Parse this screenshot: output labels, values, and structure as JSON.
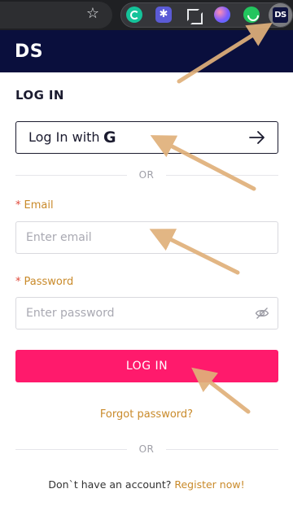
{
  "browser": {
    "extensions": [
      "grammarly-icon",
      "gear-extension-icon",
      "crop-icon",
      "orb-extension-icon",
      "smile-extension-icon",
      "ds-extension-icon"
    ],
    "active_extension_label": "DS"
  },
  "header": {
    "logo": "DS"
  },
  "login": {
    "title": "LOG IN",
    "google_button": {
      "label": "Log In with",
      "icon": "G"
    },
    "or_text": "OR",
    "email": {
      "label": "Email",
      "required_mark": "*",
      "placeholder": "Enter email",
      "value": ""
    },
    "password": {
      "label": "Password",
      "required_mark": "*",
      "placeholder": "Enter password",
      "value": ""
    },
    "submit_label": "LOG IN",
    "forgot_label": "Forgot password?",
    "or_text_2": "OR",
    "register_prompt": "Don`t have an account?",
    "register_link": "Register now!"
  },
  "colors": {
    "header_bg": "#0a0f3d",
    "accent_pink": "#ff1a6c",
    "label_gold": "#c98a2a",
    "annotation_arrow": "#e0b07a"
  }
}
